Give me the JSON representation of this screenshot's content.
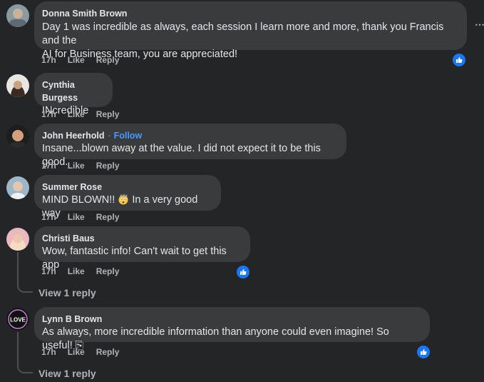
{
  "comments": [
    {
      "author": "Donna Smith Brown",
      "text_line1": "Day 1 was incredible as always, each session I learn more and more, thank you Francis and the",
      "text_line2": "AI for Business team, you are appreciated!",
      "time": "17h",
      "like": "Like",
      "reply": "Reply"
    },
    {
      "author": "Cynthia Burgess",
      "text": "INcredible",
      "time": "17h",
      "like": "Like",
      "reply": "Reply"
    },
    {
      "author": "John Heerhold",
      "separator": "·",
      "follow": "Follow",
      "text": "Insane...blown away at the value. I did not expect it to be this good.",
      "time": "17h",
      "like": "Like",
      "reply": "Reply"
    },
    {
      "author": "Summer Rose",
      "text_before": "MIND BLOWN!! ",
      "text_after": " In a very good way",
      "time": "17h",
      "like": "Like",
      "reply": "Reply"
    },
    {
      "author": "Christi Baus",
      "text": "Wow, fantastic info! Can't wait to get this app",
      "time": "17h",
      "like": "Like",
      "reply": "Reply",
      "view_replies": "View 1 reply"
    },
    {
      "author": "Lynn B Brown",
      "avatar_text": "LOVE",
      "text": "As always, more incredible information than anyone could even imagine! So useful! ⎘",
      "time": "17h",
      "like": "Like",
      "reply": "Reply",
      "view_replies": "View 1 reply"
    }
  ],
  "more_icon": "⋯",
  "colors": {
    "background": "#242526",
    "bubble": "#3a3b3c",
    "link": "#4599ff",
    "like_badge": "#1877f2"
  }
}
